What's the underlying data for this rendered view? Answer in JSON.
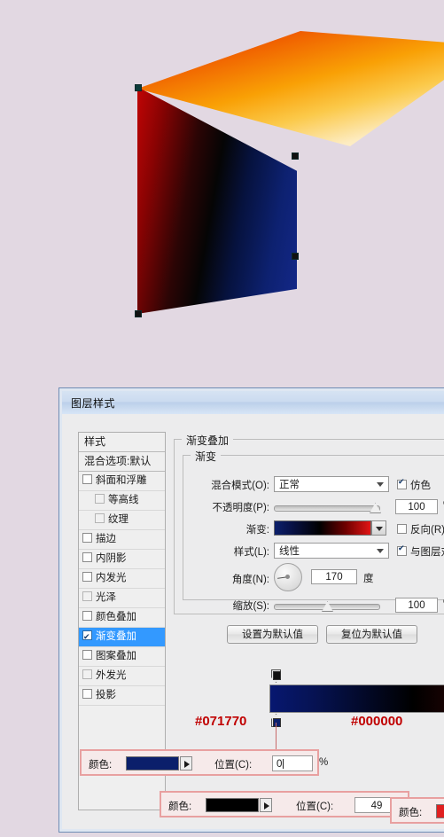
{
  "canvas": {
    "background_color": "#e2d8e2",
    "top_face_gradient": [
      "#e00000",
      "#f9a005",
      "#fdf6e2"
    ],
    "front_face_gradient": [
      "#c00505",
      "#050505",
      "#14288a"
    ]
  },
  "dialog": {
    "title": "图层样式",
    "sidebar": {
      "items": [
        {
          "label": "样式",
          "type": "head",
          "checkbox": "none",
          "selected": false
        },
        {
          "label": "混合选项:默认",
          "type": "head",
          "checkbox": "none",
          "selected": false
        },
        {
          "label": "斜面和浮雕",
          "type": "item",
          "checkbox": "off",
          "selected": false
        },
        {
          "label": "等高线",
          "type": "sub",
          "checkbox": "dim",
          "selected": false
        },
        {
          "label": "纹理",
          "type": "sub",
          "checkbox": "dim",
          "selected": false
        },
        {
          "label": "描边",
          "type": "item",
          "checkbox": "off",
          "selected": false
        },
        {
          "label": "内阴影",
          "type": "item",
          "checkbox": "off",
          "selected": false
        },
        {
          "label": "内发光",
          "type": "item",
          "checkbox": "off",
          "selected": false
        },
        {
          "label": "光泽",
          "type": "item",
          "checkbox": "off",
          "selected": false
        },
        {
          "label": "颜色叠加",
          "type": "item",
          "checkbox": "off",
          "selected": false
        },
        {
          "label": "渐变叠加",
          "type": "item",
          "checkbox": "on",
          "selected": true
        },
        {
          "label": "图案叠加",
          "type": "item",
          "checkbox": "off",
          "selected": false
        },
        {
          "label": "外发光",
          "type": "item",
          "checkbox": "dim",
          "selected": false
        },
        {
          "label": "投影",
          "type": "item",
          "checkbox": "off",
          "selected": false
        }
      ]
    },
    "panel": {
      "group_title": "渐变叠加",
      "subgroup_title": "渐变",
      "blend_mode_label": "混合模式(O):",
      "blend_mode_value": "正常",
      "dither_label": "仿色",
      "dither_checked": true,
      "opacity_label": "不透明度(P):",
      "opacity_value": "100",
      "opacity_unit": "%",
      "gradient_label": "渐变:",
      "gradient_preview": "#0b1f6b → #000000 → #e11414",
      "reverse_label": "反向(R)",
      "reverse_checked": false,
      "style_label": "样式(L):",
      "style_value": "线性",
      "align_label": "与图层对齐",
      "align_checked": true,
      "angle_label": "角度(N):",
      "angle_value": "170",
      "angle_unit": "度",
      "scale_label": "缩放(S):",
      "scale_value": "100",
      "scale_unit": "%",
      "set_default_button": "设置为默认值",
      "reset_default_button": "复位为默认值"
    },
    "gradient_editor": {
      "bar_gradient": "#071770 → #000000 (49%) → #8e0404",
      "opacity_stop_color": "#000000",
      "color_stops": [
        {
          "hex_label": "#071770",
          "swatch": "#0b1f6b",
          "position": "0"
        },
        {
          "hex_label": "#000000",
          "swatch": "#000000",
          "position": "49"
        },
        {
          "hex_label": "",
          "swatch": "#e01f1f",
          "position": ""
        }
      ],
      "callouts": [
        {
          "color_label": "颜色:",
          "swatch": "#0b1f6b",
          "pos_label": "位置(C):",
          "pos_value": "0",
          "unit": "%"
        },
        {
          "color_label": "颜色:",
          "swatch": "#000000",
          "pos_label": "位置(C):",
          "pos_value": "49",
          "unit": "%"
        },
        {
          "color_label": "颜色:",
          "swatch": "#e01f1f",
          "pos_label": "",
          "pos_value": "",
          "unit": ""
        }
      ]
    }
  }
}
